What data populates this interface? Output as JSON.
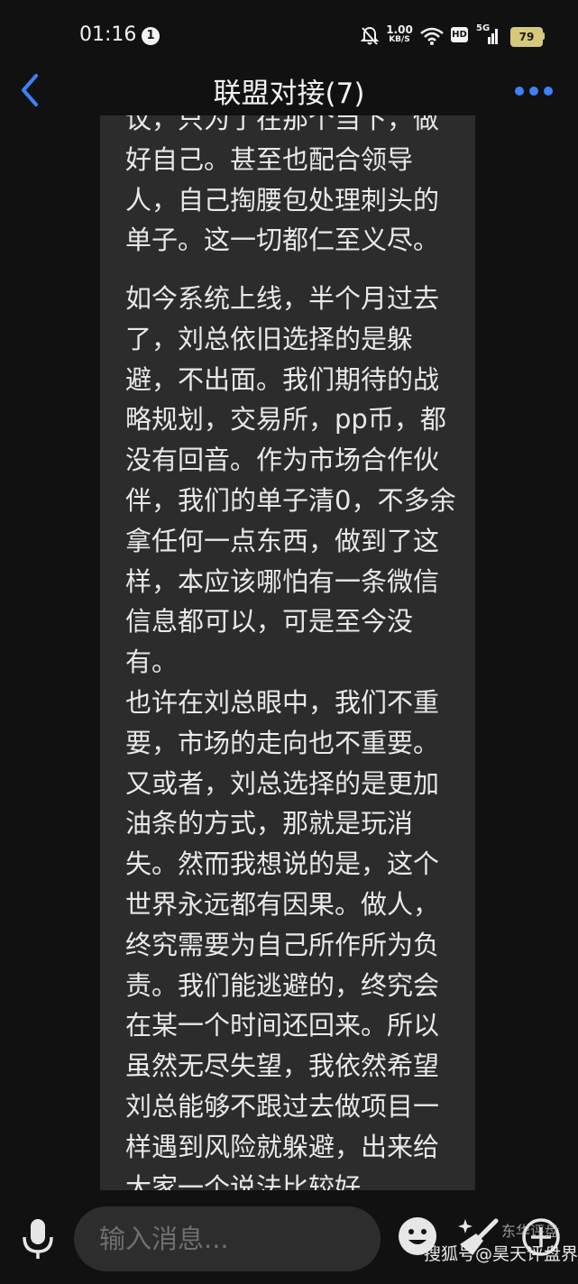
{
  "status_bar": {
    "time": "01:16",
    "notification_count": "1",
    "net_speed_value": "1.00",
    "net_speed_unit": "KB/S",
    "hd_label": "HD",
    "network_type": "5G",
    "battery_level": "79",
    "battery_color": "#d7c97a"
  },
  "header": {
    "title": "联盟对接(7)",
    "accent_color": "#3b82f6"
  },
  "message": {
    "paragraphs": [
      {
        "lines": [
          "议，只为了在那个当下，做",
          "好自己。甚至也配合领导",
          "人，自己掏腰包处理刺头的",
          "单子。这一切都仁至义尽。"
        ]
      },
      {
        "lines": [
          "如今系统上线，半个月过去",
          "了，刘总依旧选择的是躲",
          "避，不出面。我们期待的战",
          "略规划，交易所，pp币，都",
          "没有回音。作为市场合作伙",
          "伴，我们的单子清0，不多余",
          "拿任何一点东西，做到了这",
          "样，本应该哪怕有一条微信",
          "信息都可以，可是至今没",
          "有。"
        ]
      },
      {
        "lines": [
          "也许在刘总眼中，我们不重",
          "要，市场的走向也不重要。",
          "又或者，刘总选择的是更加",
          "油条的方式，那就是玩消",
          "失。然而我想说的是，这个",
          "世界永远都有因果。做人，",
          "终究需要为自己所作所为负",
          "责。我们能逃避的，终究会",
          "在某一个时间还回来。所以",
          "虽然无尽失望，我依然希望",
          "刘总能够不跟过去做项目一",
          "样遇到风险就躲避，出来给",
          "大家一个说法比较好。"
        ]
      }
    ]
  },
  "input_bar": {
    "placeholder": "输入消息..."
  },
  "watermark": {
    "main": "搜狐号@昊天评盘界",
    "overlay": "东华评盘"
  }
}
